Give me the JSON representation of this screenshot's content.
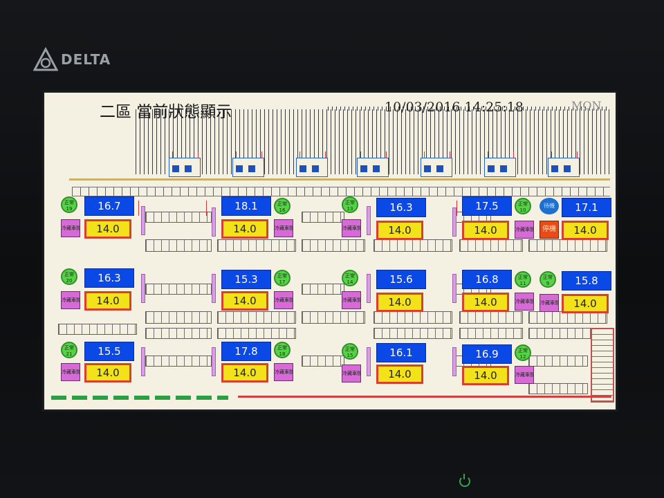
{
  "device": {
    "brand": "DELTA"
  },
  "header": {
    "title": "二區 當前狀態顯示",
    "datetime": "10/03/2016 14:25:18",
    "weekday": "MON"
  },
  "units": [
    {
      "status": "正常",
      "id": "19",
      "temp": "16.7",
      "set": "14.0",
      "mode": "冷藏車間"
    },
    {
      "status": "正常",
      "id": "16",
      "temp": "18.1",
      "set": "14.0",
      "mode": "冷藏車間"
    },
    {
      "status": "正常",
      "id": "13",
      "temp": "16.3",
      "set": "14.0",
      "mode": "冷藏車間"
    },
    {
      "status": "正常",
      "id": "10",
      "temp": "17.5",
      "set": "14.0",
      "mode": "冷藏車間"
    },
    {
      "status": "待機",
      "id": "",
      "temp": "17.1",
      "set": "14.0",
      "mode": "停機"
    },
    {
      "status": "正常",
      "id": "20",
      "temp": "16.3",
      "set": "14.0",
      "mode": "冷藏車間"
    },
    {
      "status": "正常",
      "id": "17",
      "temp": "15.3",
      "set": "14.0",
      "mode": "冷藏車間"
    },
    {
      "status": "正常",
      "id": "14",
      "temp": "15.6",
      "set": "14.0",
      "mode": "冷藏車間"
    },
    {
      "status": "正常",
      "id": "11",
      "temp": "16.8",
      "set": "14.0",
      "mode": "冷藏車間"
    },
    {
      "status": "正常",
      "id": "9",
      "temp": "15.8",
      "set": "14.0",
      "mode": "冷藏車間"
    },
    {
      "status": "正常",
      "id": "21",
      "temp": "15.5",
      "set": "14.0",
      "mode": "冷藏車間"
    },
    {
      "status": "正常",
      "id": "18",
      "temp": "17.8",
      "set": "14.0",
      "mode": "冷藏車間"
    },
    {
      "status": "正常",
      "id": "15",
      "temp": "16.1",
      "set": "14.0",
      "mode": "冷藏車間"
    },
    {
      "status": "正常",
      "id": "12",
      "temp": "16.9",
      "set": "14.0",
      "mode": "冷藏車間"
    }
  ],
  "colors": {
    "temp_bg": "#0a49e6",
    "set_bg": "#f3e21a",
    "set_border": "#d6402e",
    "status_ok": "#5ad04a",
    "mode_bg": "#d86ad8",
    "stop_bg": "#e84a1a"
  }
}
